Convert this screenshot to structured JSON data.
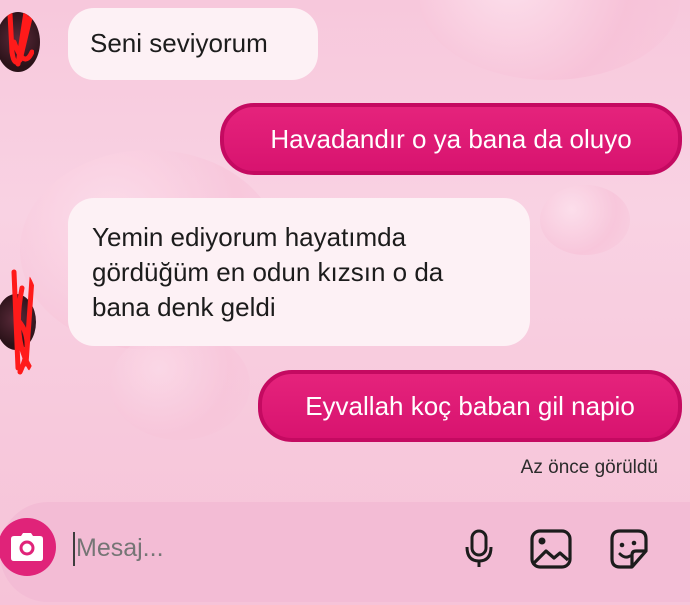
{
  "conversation": {
    "messages": [
      {
        "direction": "incoming",
        "text": "Seni seviyorum"
      },
      {
        "direction": "outgoing",
        "text": "Havadandır o ya bana da oluyo"
      },
      {
        "direction": "incoming",
        "text": "Yemin ediyorum hayatımda gördüğüm en odun kızsın o da bana denk geldi"
      },
      {
        "direction": "outgoing",
        "text": "Eyvallah koç baban gil napio"
      }
    ],
    "seen_status": "Az önce görüldü"
  },
  "composer": {
    "placeholder": "Mesaj...",
    "camera_icon": "camera-icon",
    "tools": [
      "microphone-icon",
      "gallery-icon",
      "sticker-icon"
    ]
  },
  "colors": {
    "accent": "#e02379",
    "incoming_bubble": "#fdf1f5",
    "background": "#f8cce0"
  }
}
